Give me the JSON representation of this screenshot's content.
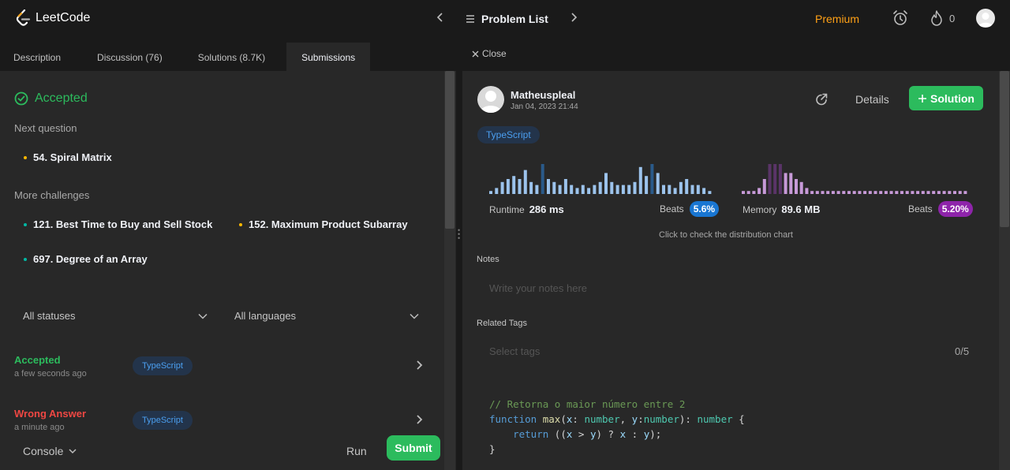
{
  "app": {
    "name": "LeetCode"
  },
  "topnav": {
    "problem_list": "Problem List",
    "premium": "Premium",
    "streak_count": "0"
  },
  "tabs": [
    {
      "label": "Description"
    },
    {
      "label": "Discussion (76)"
    },
    {
      "label": "Solutions (8.7K)"
    },
    {
      "label": "Submissions"
    }
  ],
  "left": {
    "status_title": "Accepted",
    "next_question_label": "Next question",
    "next_question": {
      "title": "54. Spiral Matrix",
      "difficulty_color": "#ffb800"
    },
    "more_challenges_label": "More challenges",
    "challenges": [
      {
        "title": "121. Best Time to Buy and Sell Stock",
        "difficulty_color": "#00b8a3"
      },
      {
        "title": "152. Maximum Product Subarray",
        "difficulty_color": "#ffb800"
      },
      {
        "title": "697. Degree of an Array",
        "difficulty_color": "#00b8a3"
      }
    ],
    "filters": {
      "status": "All statuses",
      "language": "All languages"
    },
    "submissions": [
      {
        "status": "Accepted",
        "status_color": "#2cbb5d",
        "time": "a few seconds ago",
        "language": "TypeScript"
      },
      {
        "status": "Wrong Answer",
        "status_color": "#ef4743",
        "time": "a minute ago",
        "language": "TypeScript"
      }
    ],
    "console_label": "Console",
    "run_label": "Run",
    "submit_label": "Submit"
  },
  "right": {
    "close_label": "Close",
    "user": {
      "name": "Matheuspleal",
      "date": "Jan 04, 2023 21:44"
    },
    "details_label": "Details",
    "solution_label": "Solution",
    "language_tag": "TypeScript",
    "runtime": {
      "label": "Runtime",
      "value": "286 ms",
      "beats_label": "Beats",
      "beats": "5.6%",
      "color": "#1976d2",
      "bars": [
        1,
        2,
        4,
        5,
        6,
        5,
        8,
        4,
        3,
        10,
        5,
        4,
        3,
        5,
        3,
        2,
        3,
        2,
        3,
        4,
        7,
        4,
        3,
        3,
        3,
        4,
        9,
        6,
        10,
        7,
        3,
        3,
        2,
        4,
        5,
        3,
        3,
        2,
        1
      ]
    },
    "memory": {
      "label": "Memory",
      "value": "89.6 MB",
      "beats_label": "Beats",
      "beats": "5.20%",
      "color": "#8e24aa",
      "bars": [
        1,
        1,
        1,
        2,
        5,
        10,
        10,
        10,
        7,
        7,
        5,
        4,
        2,
        1,
        1,
        1,
        1,
        1,
        1,
        1,
        1,
        1,
        1,
        1,
        1,
        1,
        1,
        1,
        1,
        1,
        1,
        1,
        1,
        1,
        1,
        1,
        1,
        1,
        1,
        1,
        1,
        1,
        1
      ]
    },
    "chart_hint": "Click to check the distribution chart",
    "notes_label": "Notes",
    "notes_placeholder": "Write your notes here",
    "tags_label": "Related Tags",
    "tags_placeholder": "Select tags",
    "tags_count": "0/5",
    "code_lines": [
      "// Retorna o maior número entre 2",
      "function max(x: number, y:number): number {",
      "    return ((x > y) ? x : y);",
      "}"
    ]
  }
}
